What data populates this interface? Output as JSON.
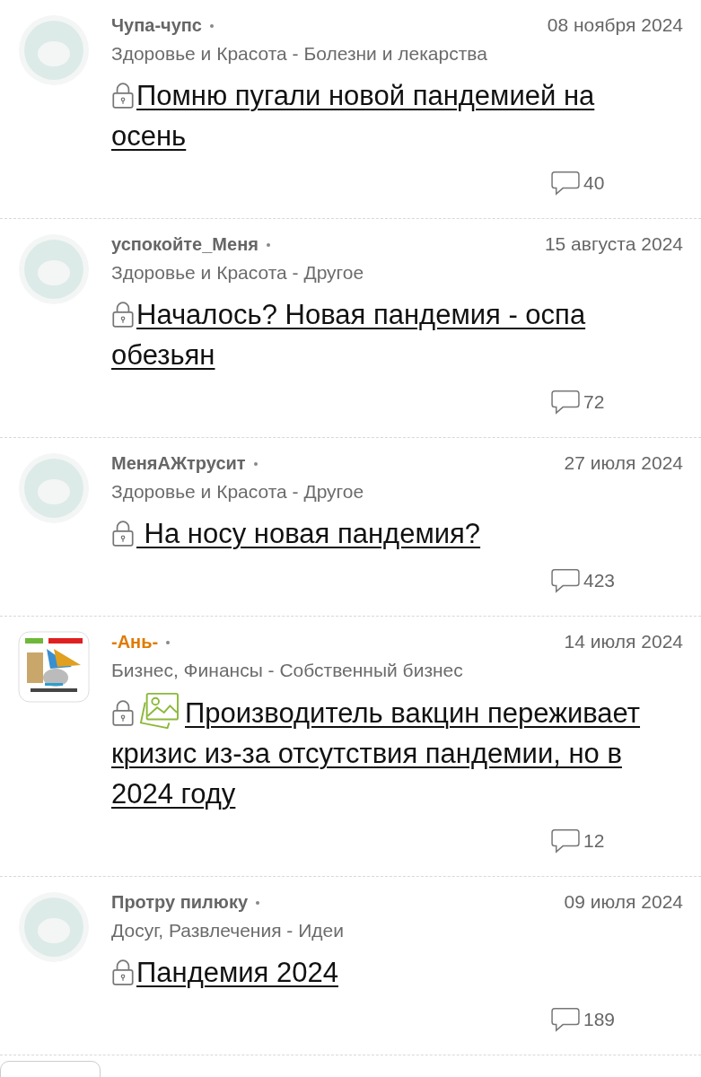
{
  "posts": [
    {
      "avatar": {
        "kind": "avatar"
      },
      "author": "Чупа-чупс",
      "color": "#666666",
      "date": "08 ноября 2024",
      "category": "Здоровье и Красота - Болезни и лекарства",
      "locked": true,
      "has_image": false,
      "title": "Помню пугали новой пандемией на осень",
      "comments": "40"
    },
    {
      "avatar": {
        "kind": "avatar"
      },
      "author": "успокойте_Меня",
      "color": "#666666",
      "date": "15 августа 2024",
      "category": "Здоровье и Красота - Другое",
      "locked": true,
      "has_image": false,
      "title": "Началось? Новая пандемия - оспа обезьян",
      "comments": "72"
    },
    {
      "avatar": {
        "kind": "avatar"
      },
      "author": "МеняАЖтрусит",
      "color": "#666666",
      "date": "27 июля 2024",
      "category": "Здоровье и Красота - Другое",
      "locked": true,
      "has_image": false,
      "title": " На носу новая пандемия?",
      "comments": "423"
    },
    {
      "author": "-Ань-",
      "color": "#e07b00",
      "date": "14 июля 2024",
      "category": "Бизнес, Финансы - Собственный бизнес",
      "locked": true,
      "has_image": true,
      "title": "Производитель вакцин переживает кризис из-за отсутствия пандемии, но в 2024 году",
      "comments": "12"
    },
    {
      "avatar": {
        "kind": "avatar"
      },
      "author": "Протру пилюку",
      "color": "#666666",
      "date": "09 июля 2024",
      "category": "Досуг, Развлечения - Идеи",
      "locked": true,
      "has_image": false,
      "title": "Пандемия 2024",
      "comments": "189"
    }
  ]
}
